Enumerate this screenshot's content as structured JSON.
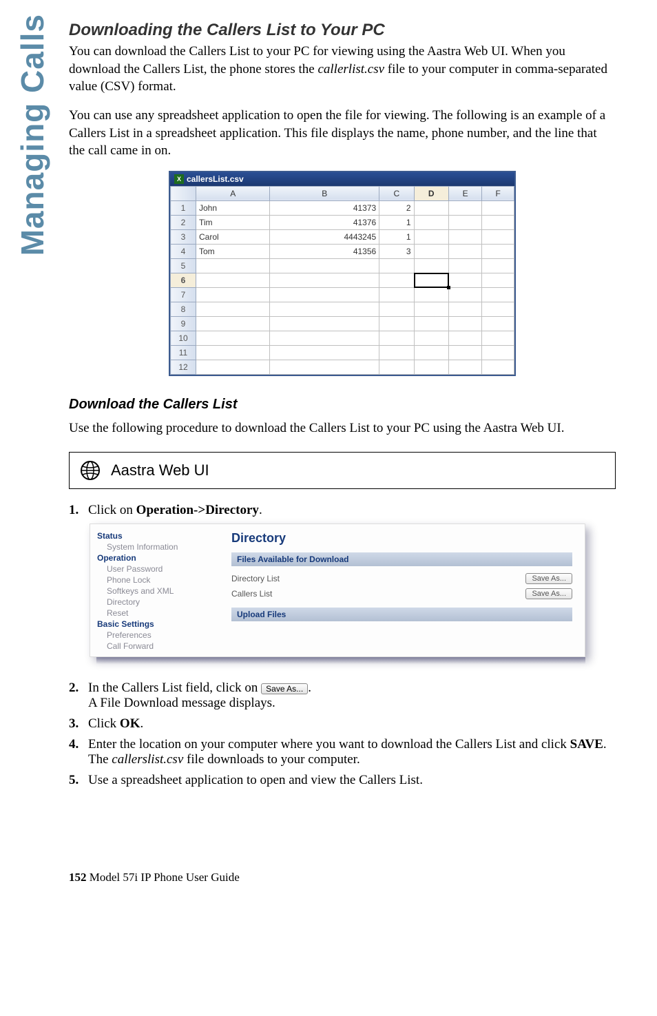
{
  "sideTab": "Managing Calls",
  "h1": "Downloading the Callers List to Your PC",
  "para1a": "You can download the Callers List to your PC for viewing using the Aastra Web UI. When you download the Callers List, the phone stores the ",
  "para1b": "callerlist.csv",
  "para1c": " file to your computer in comma-separated value (CSV) format.",
  "para2": "You can use any spreadsheet application to open the file for viewing. The following is an example of a Callers List in a spreadsheet application. This file displays the name, phone number, and the line that the call came in on.",
  "spreadsheet": {
    "title": "callersList.csv",
    "cols": [
      "A",
      "B",
      "C",
      "D",
      "E",
      "F"
    ],
    "rows": [
      {
        "name": "John",
        "num": "41373",
        "line": "2"
      },
      {
        "name": "Tim",
        "num": "41376",
        "line": "1"
      },
      {
        "name": "Carol",
        "num": "4443245",
        "line": "1"
      },
      {
        "name": "Tom",
        "num": "41356",
        "line": "3"
      }
    ],
    "emptyRows": 8,
    "selectedCell": {
      "row": 6,
      "col": "D"
    }
  },
  "h2": "Download the Callers List",
  "para3": "Use the following procedure to download the Callers List to your PC using the Aastra Web UI",
  "webuiLabel": "Aastra Web UI",
  "step1": {
    "num": "1.",
    "prefix": "Click on ",
    "bold": "Operation->Directory",
    "suffix": "."
  },
  "webpanel": {
    "side": {
      "status": "Status",
      "sysinfo": "System Information",
      "operation": "Operation",
      "userpw": "User Password",
      "phonelock": "Phone Lock",
      "softkeys": "Softkeys and XML",
      "directory": "Directory",
      "reset": "Reset",
      "basic": "Basic Settings",
      "prefs": "Preferences",
      "callfwd": "Call Forward"
    },
    "main": {
      "title": "Directory",
      "bar1": "Files Available for Download",
      "row1": "Directory List",
      "row2": "Callers List",
      "btn": "Save As...",
      "bar2": "Upload Files"
    }
  },
  "step2": {
    "num": "2.",
    "prefix": "In the Callers List field, click on ",
    "btn": "Save As...",
    "suffix": ".",
    "line2": "A File Download message displays."
  },
  "step3": {
    "num": "3.",
    "prefix": "Click ",
    "bold": "OK",
    "suffix": "."
  },
  "step4": {
    "num": "4.",
    "prefix": "Enter the location on your computer where you want to download the Callers List and click ",
    "bold": "SAVE",
    "suffix": ".",
    "line2a": "The ",
    "line2b": "callerslist.csv",
    "line2c": " file downloads to your computer."
  },
  "step5": {
    "num": "5.",
    "text": "Use a spreadsheet application to open and view the Callers List."
  },
  "footer": {
    "page": "152",
    "text": "  Model 57i IP Phone User Guide"
  }
}
